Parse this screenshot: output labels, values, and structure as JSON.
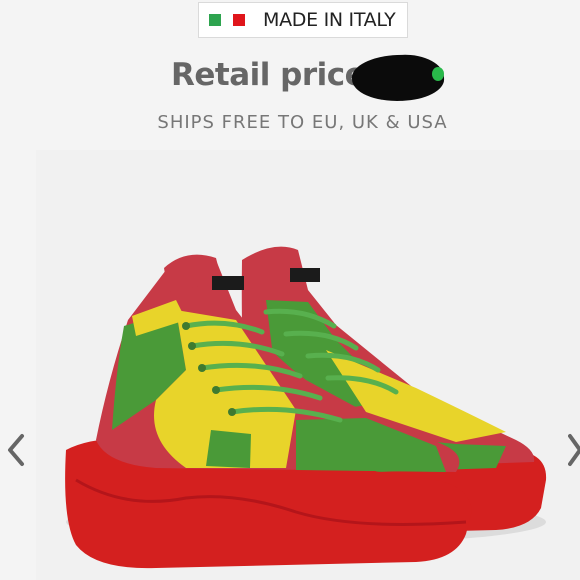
{
  "badge": {
    "text": "MADE IN ITALY",
    "flag_colors": [
      "#2ea44f",
      "#ffffff",
      "#e0161b"
    ],
    "flag_icon": "italy-flag-icon"
  },
  "price": {
    "label": "Retail price:",
    "value_redacted": true
  },
  "shipping": {
    "text": "SHIPS FREE TO EU, UK & USA"
  },
  "gallery": {
    "prev_icon": "chevron-left-icon",
    "next_icon": "chevron-right-icon",
    "image_subject": "high-top-sneaker"
  },
  "colors": {
    "sole": "#d4201f",
    "upper_red": "#c73a46",
    "upper_yellow": "#e8d42a",
    "upper_green": "#4a9a38",
    "laces": "#58b04e"
  }
}
